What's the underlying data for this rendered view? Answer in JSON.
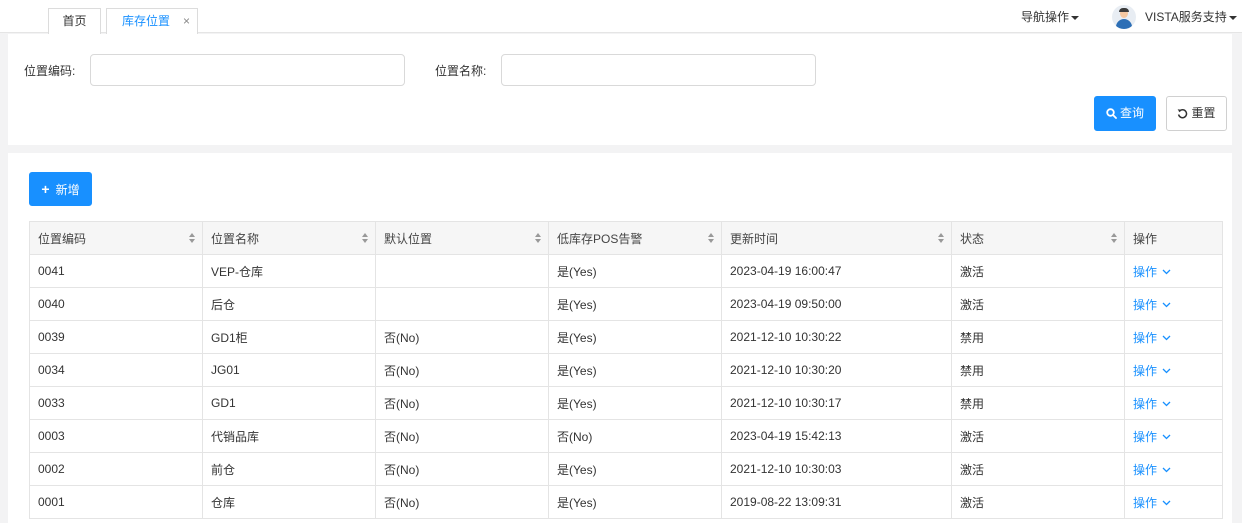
{
  "tabs": {
    "home": "首页",
    "active": "库存位置",
    "close_glyph": "×"
  },
  "header": {
    "nav_ops": "导航操作",
    "user_name": "VISTA服务支持"
  },
  "search": {
    "code_label": "位置编码:",
    "code_value": "",
    "name_label": "位置名称:",
    "name_value": "",
    "query_label": "查询",
    "reset_label": "重置"
  },
  "toolbar": {
    "add_label": "新增"
  },
  "table": {
    "columns": [
      "位置编码",
      "位置名称",
      "默认位置",
      "低库存POS告警",
      "更新时间",
      "状态",
      "操作"
    ],
    "rows": [
      {
        "code": "0041",
        "name": "VEP-仓库",
        "default": "",
        "alert": "是(Yes)",
        "updated": "2023-04-19 16:00:47",
        "status": "激活",
        "op": "操作"
      },
      {
        "code": "0040",
        "name": "后仓",
        "default": "",
        "alert": "是(Yes)",
        "updated": "2023-04-19 09:50:00",
        "status": "激活",
        "op": "操作"
      },
      {
        "code": "0039",
        "name": "GD1柜",
        "default": "否(No)",
        "alert": "是(Yes)",
        "updated": "2021-12-10 10:30:22",
        "status": "禁用",
        "op": "操作"
      },
      {
        "code": "0034",
        "name": "JG01",
        "default": "否(No)",
        "alert": "是(Yes)",
        "updated": "2021-12-10 10:30:20",
        "status": "禁用",
        "op": "操作"
      },
      {
        "code": "0033",
        "name": "GD1",
        "default": "否(No)",
        "alert": "是(Yes)",
        "updated": "2021-12-10 10:30:17",
        "status": "禁用",
        "op": "操作"
      },
      {
        "code": "0003",
        "name": "代销品库",
        "default": "否(No)",
        "alert": "否(No)",
        "updated": "2023-04-19 15:42:13",
        "status": "激活",
        "op": "操作"
      },
      {
        "code": "0002",
        "name": "前仓",
        "default": "否(No)",
        "alert": "是(Yes)",
        "updated": "2021-12-10 10:30:03",
        "status": "激活",
        "op": "操作"
      },
      {
        "code": "0001",
        "name": "仓库",
        "default": "否(No)",
        "alert": "是(Yes)",
        "updated": "2019-08-22 13:09:31",
        "status": "激活",
        "op": "操作"
      }
    ]
  },
  "icons": {
    "tab_close": "close-icon",
    "nav_caret": "caret-down-icon",
    "avatar": "user-avatar",
    "query": "search-icon",
    "reset": "undo-icon",
    "add": "plus-icon",
    "sort": "sort-icon",
    "op_chevron": "chevron-down-icon"
  },
  "colors": {
    "primary": "#1890ff",
    "header_bg": "#f6f6f6",
    "page_bg": "#f3f3f4"
  }
}
